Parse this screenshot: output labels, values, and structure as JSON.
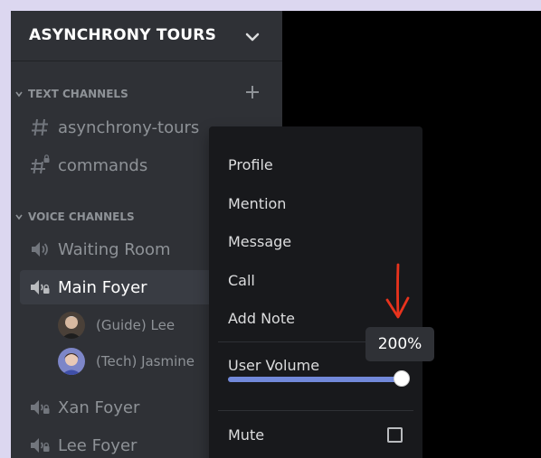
{
  "server": {
    "name": "ASYNCHRONY TOURS"
  },
  "categories": {
    "text": "TEXT CHANNELS",
    "voice": "VOICE CHANNELS"
  },
  "text_channels": [
    "asynchrony-tours",
    "commands"
  ],
  "voice_channels": {
    "waiting_room": "Waiting Room",
    "main_foyer": "Main Foyer",
    "members": [
      "(Guide) Lee",
      "(Tech) Jasmine"
    ],
    "xan_foyer": "Xan Foyer",
    "lee_foyer": "Lee Foyer"
  },
  "context_menu": {
    "profile": "Profile",
    "mention": "Mention",
    "message": "Message",
    "call": "Call",
    "add_note": "Add Note",
    "user_volume": "User Volume",
    "volume_level_percent": 200,
    "volume_max_percent": 200,
    "mute": "Mute"
  },
  "tooltip": {
    "volume": "200%"
  },
  "colors": {
    "sidebar": "#2f3136",
    "menu": "#18191c",
    "accent": "#7289da",
    "arrow": "#e8331d"
  }
}
